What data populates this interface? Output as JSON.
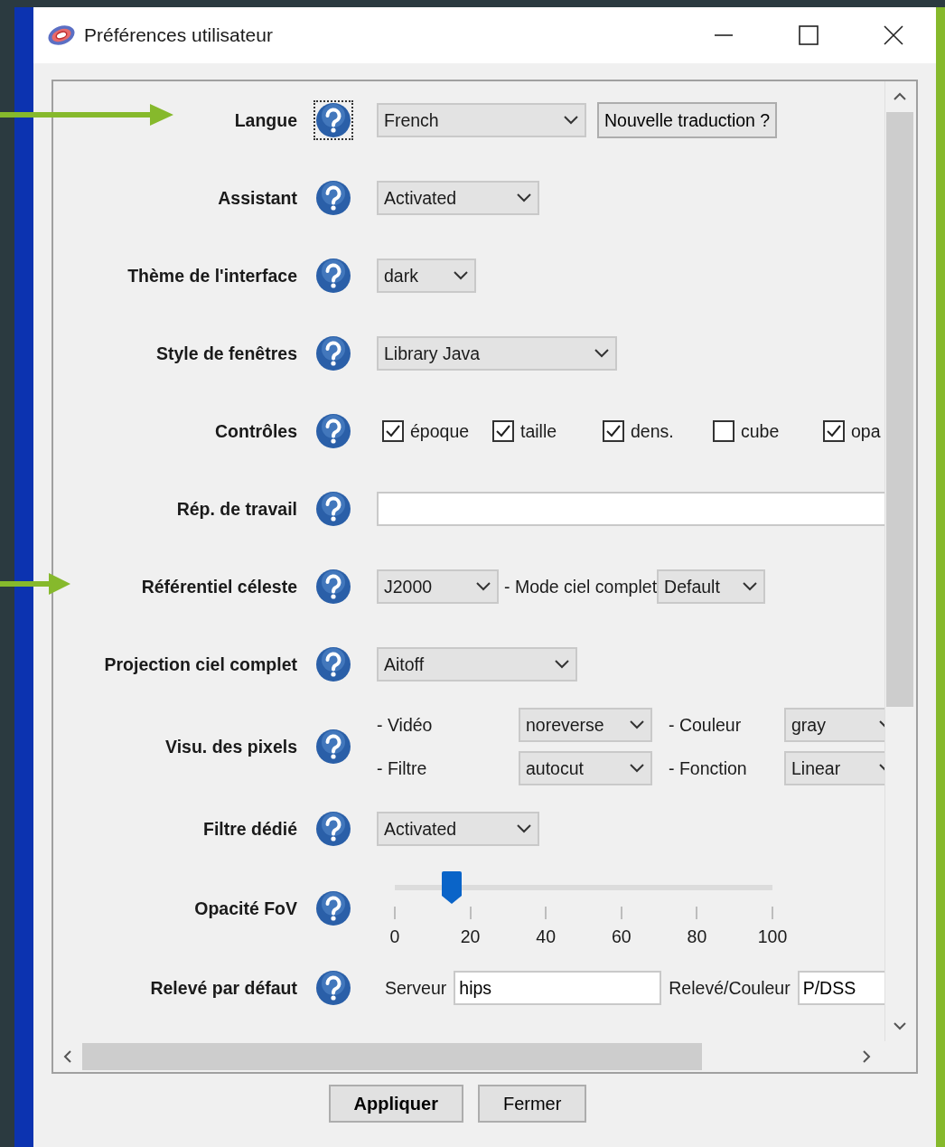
{
  "window": {
    "title": "Préférences utilisateur"
  },
  "rows": [
    {
      "label": "Langue",
      "help_focused": true,
      "kind": "inline",
      "items": [
        {
          "kind": "select",
          "value": "French"
        },
        {
          "kind": "button",
          "label": "Nouvelle traduction ?"
        }
      ]
    },
    {
      "label": "Assistant",
      "help_focused": false,
      "kind": "inline",
      "items": [
        {
          "kind": "select",
          "value": "Activated"
        }
      ]
    },
    {
      "label": "Thème de l'interface",
      "help_focused": false,
      "kind": "inline",
      "items": [
        {
          "kind": "select",
          "value": "dark"
        }
      ]
    },
    {
      "label": "Style de fenêtres",
      "help_focused": false,
      "kind": "inline",
      "items": [
        {
          "kind": "select",
          "value": "Library Java"
        }
      ]
    },
    {
      "label": "Contrôles",
      "help_focused": false,
      "kind": "checks",
      "items": [
        {
          "kind": "checkbox",
          "label": "époque",
          "checked": true
        },
        {
          "kind": "checkbox",
          "label": "taille",
          "checked": true
        },
        {
          "kind": "checkbox",
          "label": "dens.",
          "checked": true
        },
        {
          "kind": "checkbox",
          "label": "cube",
          "checked": false
        },
        {
          "kind": "checkbox",
          "label": "opa",
          "checked": true
        }
      ]
    },
    {
      "label": "Rép. de travail",
      "help_focused": false,
      "kind": "inline",
      "items": [
        {
          "kind": "input",
          "value": ""
        }
      ]
    },
    {
      "label": "Référentiel céleste",
      "help_focused": false,
      "kind": "inline",
      "items": [
        {
          "kind": "select",
          "value": "J2000"
        },
        {
          "kind": "text",
          "label": "- Mode ciel complet"
        },
        {
          "kind": "select",
          "value": "Default"
        }
      ]
    },
    {
      "label": "Projection ciel complet",
      "help_focused": false,
      "kind": "inline",
      "items": [
        {
          "kind": "select",
          "value": "Aitoff"
        }
      ]
    },
    {
      "label": "Visu. des pixels",
      "help_focused": false,
      "kind": "grid",
      "lines": [
        [
          {
            "kind": "text",
            "label": "- Vidéo"
          },
          {
            "kind": "select",
            "value": "noreverse"
          },
          {
            "kind": "text",
            "label": "- Couleur"
          },
          {
            "kind": "select",
            "value": "gray"
          }
        ],
        [
          {
            "kind": "text",
            "label": "- Filtre"
          },
          {
            "kind": "select",
            "value": "autocut"
          },
          {
            "kind": "text",
            "label": "- Fonction"
          },
          {
            "kind": "select",
            "value": "Linear"
          }
        ]
      ]
    },
    {
      "label": "Filtre dédié",
      "help_focused": false,
      "kind": "inline",
      "items": [
        {
          "kind": "select",
          "value": "Activated"
        }
      ]
    },
    {
      "label": "Opacité FoV",
      "help_focused": false,
      "kind": "slider",
      "level": 0.15,
      "ticks": [
        "0",
        "20",
        "40",
        "60",
        "80",
        "100"
      ]
    },
    {
      "label": "Relevé par défaut",
      "help_focused": false,
      "kind": "inline",
      "items": [
        {
          "kind": "text",
          "label": "Serveur"
        },
        {
          "kind": "input",
          "value": "hips"
        },
        {
          "kind": "text",
          "label": "Relevé/Couleur"
        },
        {
          "kind": "input",
          "value": "P/DSS"
        }
      ]
    }
  ],
  "buttons": [
    {
      "label": "Appliquer",
      "default": true
    },
    {
      "label": "Fermer",
      "default": false
    }
  ]
}
